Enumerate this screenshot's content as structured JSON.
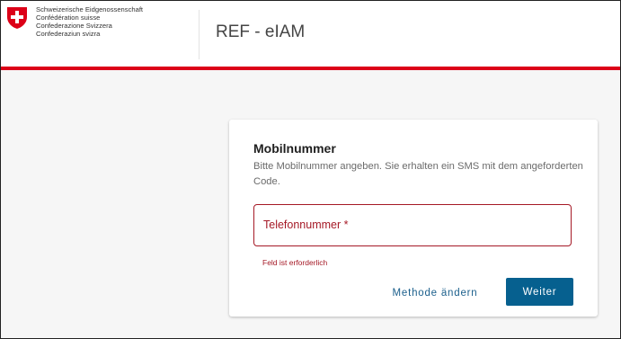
{
  "header": {
    "confederation_lines": [
      "Schweizerische Eidgenossenschaft",
      "Confédération suisse",
      "Confederazione Svizzera",
      "Confederaziun svizra"
    ],
    "app_title": "REF - eIAM",
    "logo_icon": "swiss-cross-shield-icon",
    "accent_color": "#dc0018"
  },
  "card": {
    "title": "Mobilnummer",
    "description": "Bitte Mobilnummer angeben. Sie erhalten ein SMS mit dem angeforderten Code.",
    "phone_field": {
      "label": "Telefonnummer *",
      "value": "",
      "error": "Feld ist erforderlich"
    },
    "change_method_label": "Methode ändern",
    "next_label": "Weiter"
  },
  "colors": {
    "error": "#a51926",
    "primary": "#06608f",
    "link": "#1b5f8c"
  }
}
